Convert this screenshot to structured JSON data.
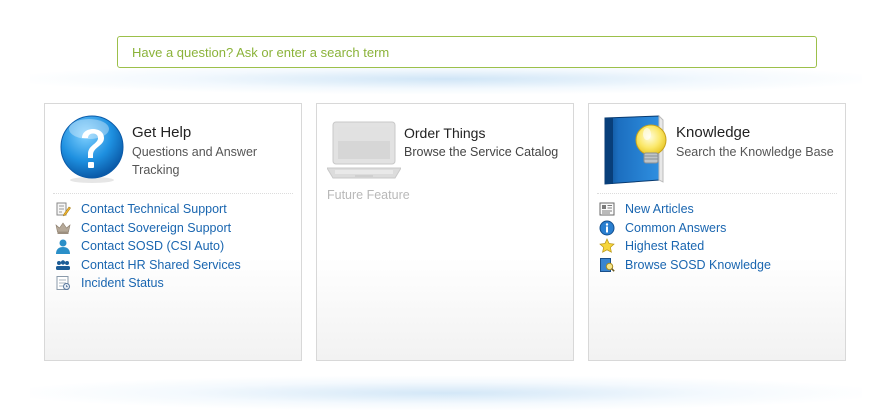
{
  "search": {
    "placeholder": "Have a question? Ask or enter a search term"
  },
  "panels": {
    "help": {
      "title": "Get Help",
      "subtitle": "Questions and Answer Tracking",
      "icon": "question-icon",
      "links": [
        {
          "label": "Contact Technical Support",
          "icon": "support-pencil-icon"
        },
        {
          "label": "Contact Sovereign Support",
          "icon": "crown-icon"
        },
        {
          "label": "Contact SOSD (CSI Auto)",
          "icon": "user-icon"
        },
        {
          "label": "Contact HR Shared Services",
          "icon": "group-icon"
        },
        {
          "label": "Incident Status",
          "icon": "status-icon"
        }
      ]
    },
    "order": {
      "title": "Order Things",
      "subtitle": "Browse the Service Catalog",
      "icon": "laptop-icon",
      "note": "Future Feature"
    },
    "knowledge": {
      "title": "Knowledge",
      "subtitle": "Search the Knowledge Base",
      "icon": "knowledge-book-icon",
      "links": [
        {
          "label": "New Articles",
          "icon": "news-icon"
        },
        {
          "label": "Common Answers",
          "icon": "info-icon"
        },
        {
          "label": "Highest Rated",
          "icon": "star-icon"
        },
        {
          "label": "Browse SOSD Knowledge",
          "icon": "browse-book-icon"
        }
      ]
    }
  },
  "colors": {
    "link": "#1a66b0",
    "search_border": "#9cc04a",
    "placeholder": "#8bb33a"
  }
}
